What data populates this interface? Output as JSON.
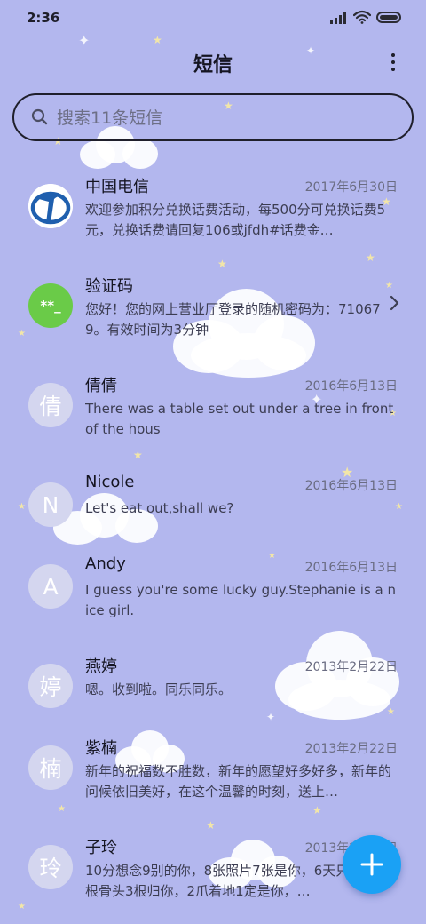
{
  "status_bar": {
    "time": "2:36"
  },
  "header": {
    "title": "短信"
  },
  "search": {
    "placeholder": "搜索11条短信"
  },
  "conversations": [
    {
      "name": "中国电信",
      "date": "2017年6月30日",
      "preview": "欢迎参加积分兑换话费活动，每500分可兑换话费5元，兑换话费请回复106或jfdh#话费金…",
      "avatar_icon": "china-telecom-logo"
    },
    {
      "name": "验证码",
      "date": "",
      "preview": "您好！您的网上营业厅登录的随机密码为：710679。有效时间为3分钟",
      "avatar_text": "**_"
    },
    {
      "name": "倩倩",
      "date": "2016年6月13日",
      "preview": "There was a table set out under a tree in front of the hous",
      "avatar_text": "倩"
    },
    {
      "name": "Nicole",
      "date": "2016年6月13日",
      "preview": "Let's eat out,shall we?",
      "avatar_text": "N"
    },
    {
      "name": "Andy",
      "date": "2016年6月13日",
      "preview": "I guess you're some lucky guy.Stephanie is a nice girl.",
      "avatar_text": "A"
    },
    {
      "name": "燕婷",
      "date": "2013年2月22日",
      "preview": "嗯。收到啦。同乐同乐。",
      "avatar_text": "婷"
    },
    {
      "name": "紫楠",
      "date": "2013年2月22日",
      "preview": "新年的祝福数不胜数，新年的愿望好多好多，新年的问候依旧美好，在这个温馨的时刻，送上…",
      "avatar_text": "楠"
    },
    {
      "name": "子玲",
      "date": "2013年2月22日",
      "preview": "10分想念9别的你，8张照片7张是你，6天只像你，4根骨头3根归你，2爪着地1定是你，…",
      "avatar_text": "玲"
    }
  ],
  "icons": {
    "more": "more-vertical-icon",
    "search": "search-icon",
    "chevron": "chevron-right-icon",
    "compose": "plus-icon"
  },
  "colors": {
    "background": "#b3b7ee",
    "fab": "#1aa1f5",
    "verify_avatar": "#6acb48"
  }
}
